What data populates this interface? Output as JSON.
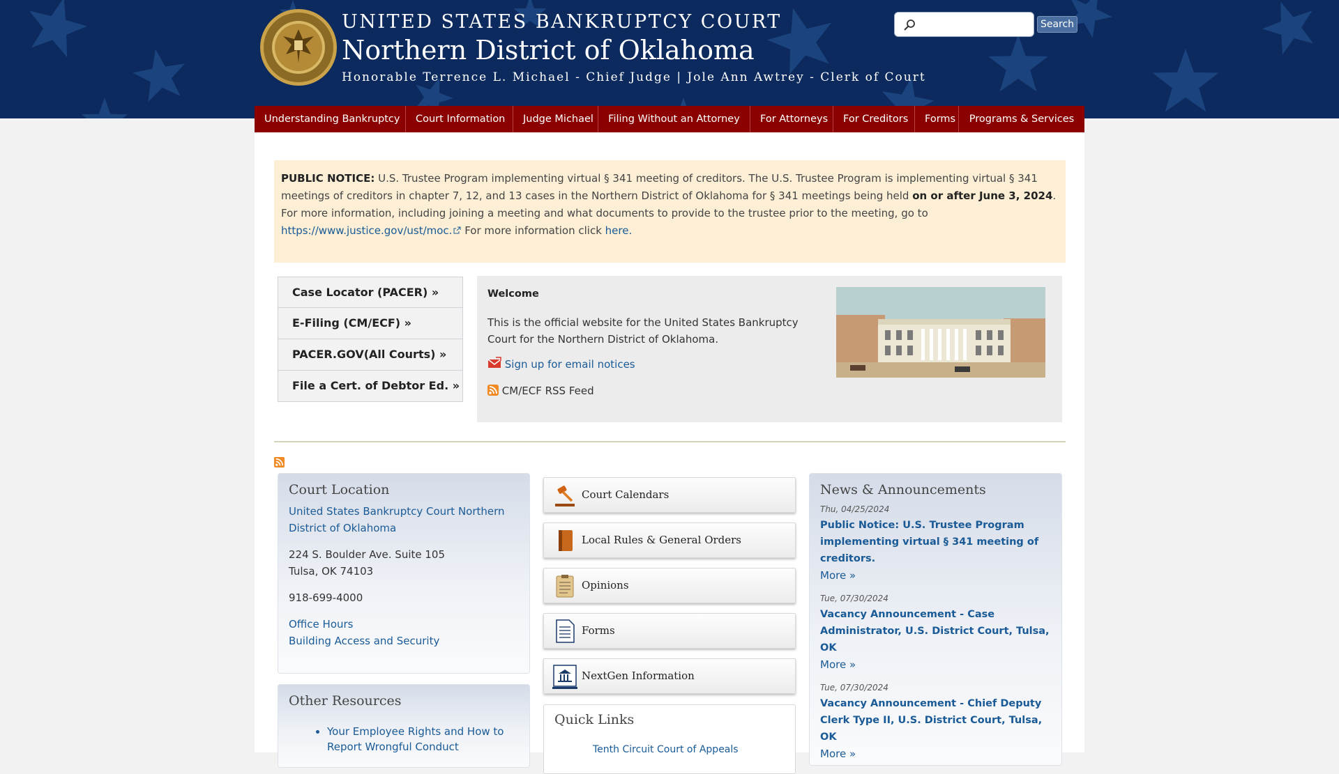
{
  "header": {
    "court_name": "UNITED STATES BANKRUPTCY COURT",
    "district": "Northern District of Oklahoma",
    "judges": "Honorable Terrence L. Michael - Chief Judge | Jole Ann Awtrey - Clerk of Court",
    "search_placeholder": "",
    "search_button": "Search"
  },
  "nav": [
    "Understanding Bankruptcy",
    "Court Information",
    "Judge Michael",
    "Filing Without an Attorney",
    "For Attorneys",
    "For Creditors",
    "Forms",
    "Programs & Services"
  ],
  "notice": {
    "label": "PUBLIC NOTICE:",
    "text1": " U.S. Trustee Program implementing virtual § 341 meeting of creditors. The U.S. Trustee Program is implementing virtual § 341 meetings of creditors in chapter 7, 12, and 13 cases in the Northern District of Oklahoma for § 341 meetings being held ",
    "bold_date": "on or after June 3, 2024",
    "text2": ". For more information, including joining a meeting and what documents to provide to the trustee prior to the meeting, go to ",
    "link_url": "https://www.justice.gov/ust/moc.",
    "text3": " For more information click ",
    "link_here": "here."
  },
  "quick_links": [
    "Case Locator (PACER) »",
    "E-Filing (CM/ECF) »",
    "PACER.GOV(All Courts) »",
    "File a Cert. of Debtor Ed. »"
  ],
  "welcome": {
    "title": "Welcome",
    "text": "This is the official website for the United States Bankruptcy Court for the Northern District of Oklahoma.",
    "email_link": "Sign up for email notices",
    "rss_label": "CM/ECF RSS Feed"
  },
  "court_location": {
    "title": "Court Location",
    "name_link": "United States Bankruptcy Court Northern District of Oklahoma",
    "address1": "224 S. Boulder Ave. Suite 105",
    "address2": "Tulsa, OK 74103",
    "phone": "918-699-4000",
    "hours_link": "Office Hours",
    "security_link": "Building Access and Security"
  },
  "other_resources": {
    "title": "Other Resources",
    "item1": "Your Employee Rights and How to Report Wrongful Conduct"
  },
  "features": [
    "Court Calendars",
    "Local Rules & General Orders",
    "Opinions",
    "Forms",
    "NextGen Information"
  ],
  "quick_links_panel": {
    "title": "Quick Links",
    "item1": "Tenth Circuit Court of Appeals"
  },
  "news": {
    "title": "News & Announcements",
    "more_label": "More »",
    "items": [
      {
        "date": "Thu, 04/25/2024",
        "title": "Public Notice: U.S. Trustee Program implementing virtual § 341 meeting of creditors."
      },
      {
        "date": "Tue, 07/30/2024",
        "title": "Vacancy Announcement - Case Administrator, U.S. District Court, Tulsa, OK"
      },
      {
        "date": "Tue, 07/30/2024",
        "title": "Vacancy Announcement - Chief Deputy Clerk Type II, U.S. District Court, Tulsa, OK"
      }
    ]
  },
  "colors": {
    "header_bg": "#0c2a5e",
    "nav_bg": "#8b0000",
    "notice_bg": "#fcefd5",
    "link": "#1a5a96"
  }
}
